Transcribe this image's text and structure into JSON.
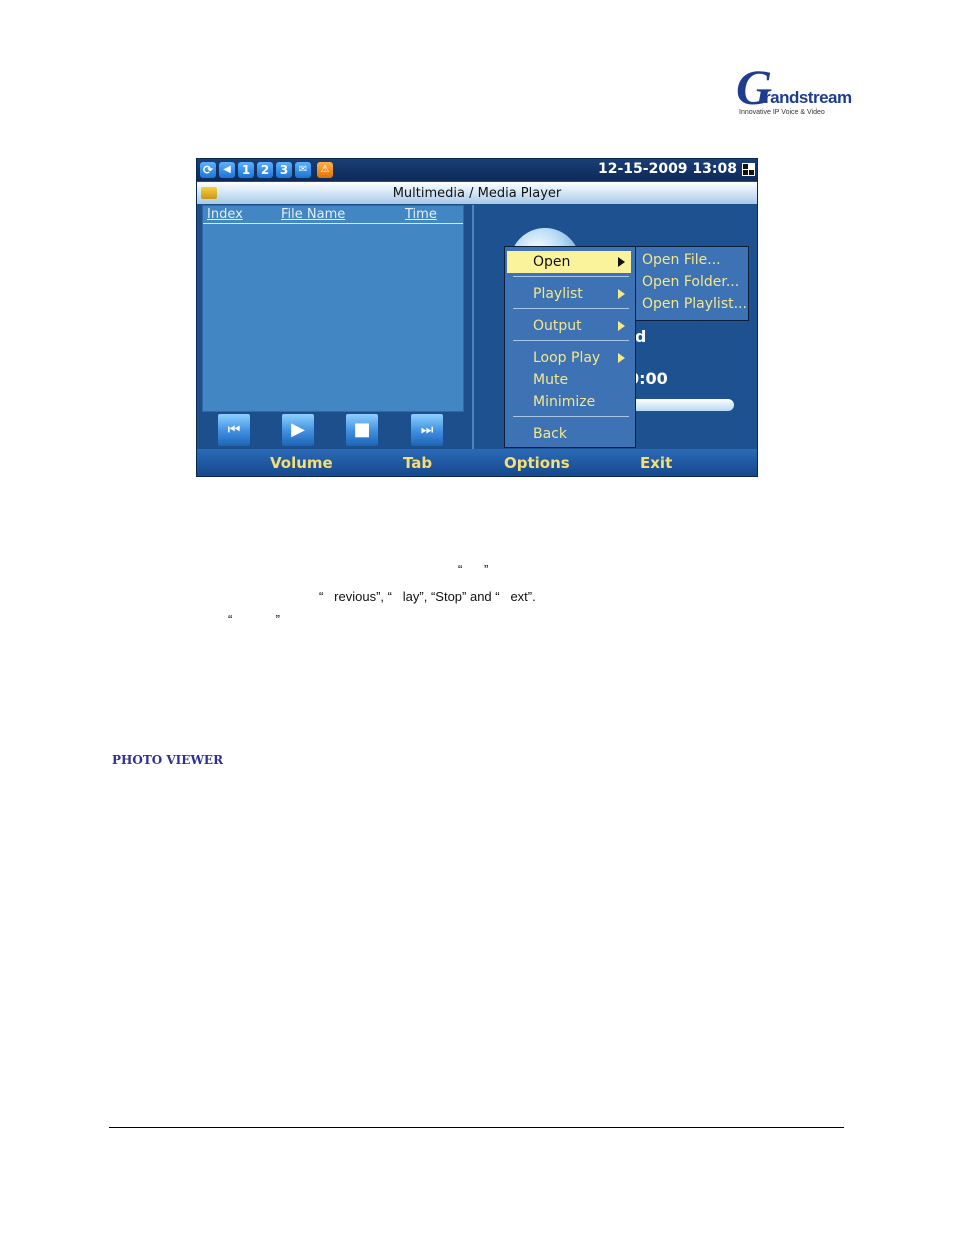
{
  "logo": {
    "letter": "G",
    "word": "randstream",
    "tagline": "Innovative IP Voice & Video"
  },
  "screenshot": {
    "status_bar": {
      "icons": [
        "sync-icon",
        "speaker-icon",
        "line-1-icon",
        "line-2-icon",
        "line-3-icon",
        "message-icon",
        "warning-icon"
      ],
      "line_labels": [
        "1",
        "2",
        "3"
      ],
      "datetime": "12-15-2009 13:08"
    },
    "title": "Multimedia / Media Player",
    "columns": [
      "Index",
      "File Name",
      "Time"
    ],
    "controls": [
      "previous-icon",
      "play-icon",
      "stop-icon",
      "next-icon"
    ],
    "status_text": "ed",
    "time_text": "0:00",
    "softkeys": [
      "Volume",
      "Tab",
      "Options",
      "Exit"
    ],
    "options_menu": {
      "items": [
        {
          "label": "Open",
          "submenu": true,
          "selected": true
        },
        {
          "label": "Playlist",
          "submenu": true
        },
        {
          "label": "Output",
          "submenu": true
        },
        {
          "label": "Loop Play",
          "submenu": true
        },
        {
          "label": "Mute"
        },
        {
          "label": "Minimize"
        },
        {
          "label": "Back"
        }
      ]
    },
    "open_submenu": [
      "Open File...",
      "Open Folder...",
      "Open Playlist..."
    ]
  },
  "document": {
    "quote_line": "“      ”",
    "buttons_line": "“   revious”, “   lay”, “Stop” and “   ext”.",
    "quote_line_2": "“            ”",
    "section_heading": "PHOTO VIEWER"
  },
  "colors": {
    "accent_menu_text": "#f5e78b",
    "selection": "#fbf39c",
    "heading": "#2e3192"
  }
}
